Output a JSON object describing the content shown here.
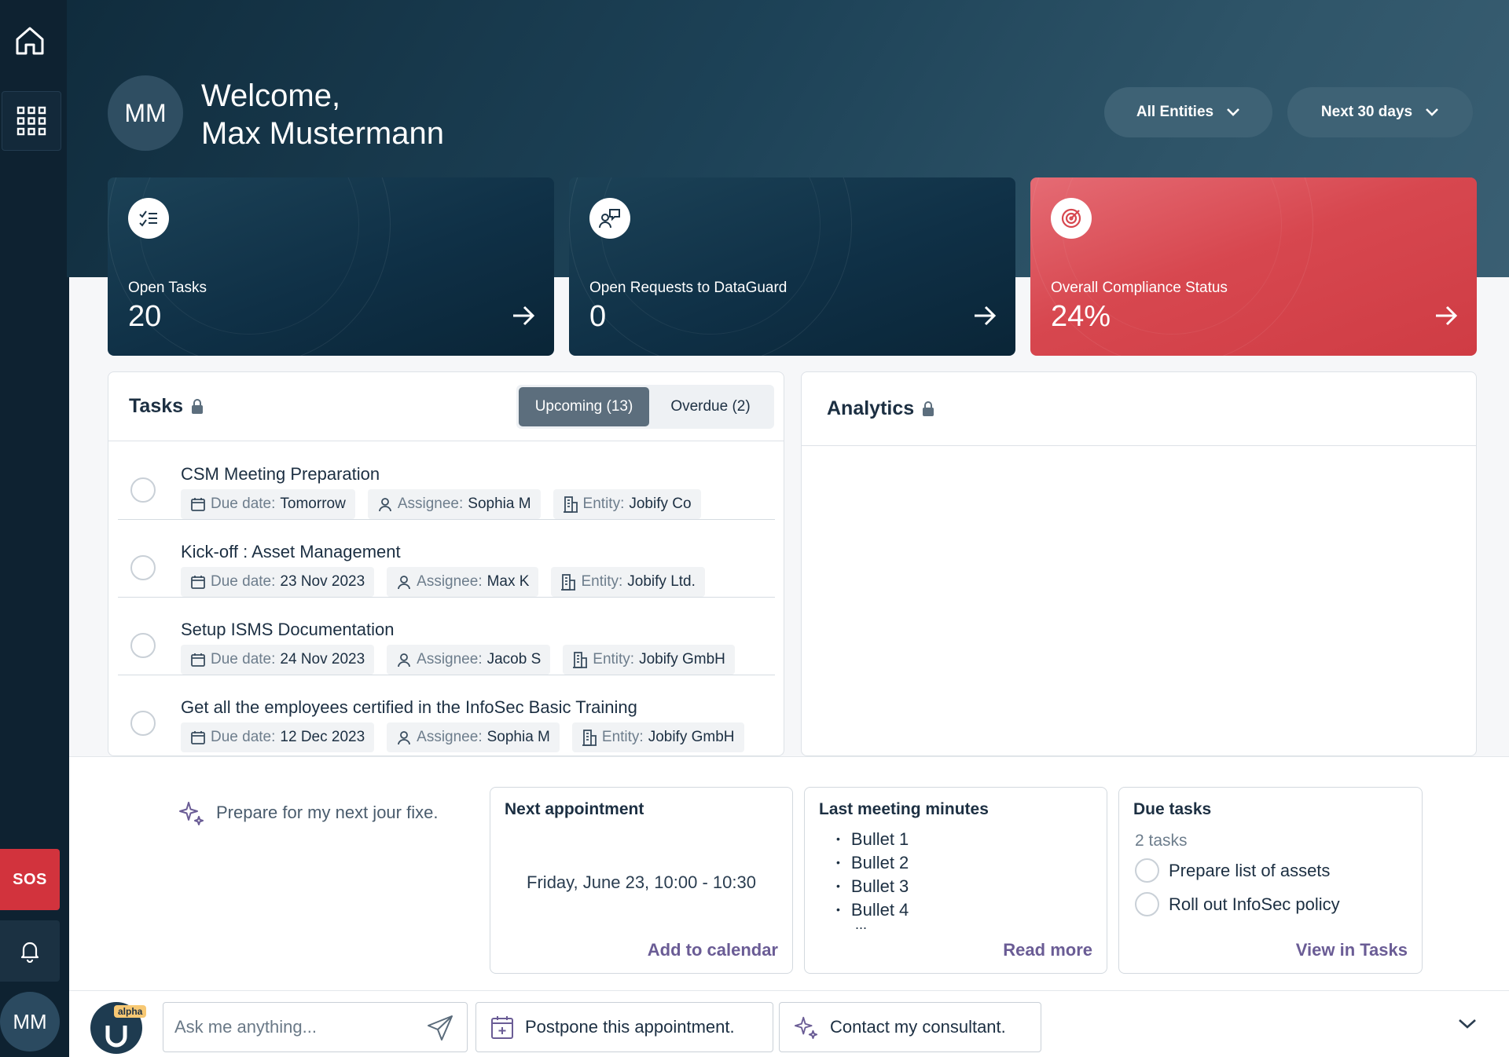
{
  "sidebar": {
    "sos_label": "SOS",
    "avatar_initials": "MM"
  },
  "header": {
    "avatar_initials": "MM",
    "welcome_line1": "Welcome,",
    "welcome_line2": "Max Mustermann",
    "filter_entities": "All Entities",
    "filter_period": "Next 30 days"
  },
  "kpis": [
    {
      "label": "Open Tasks",
      "value": "20"
    },
    {
      "label": "Open Requests to DataGuard",
      "value": "0"
    },
    {
      "label": "Overall Compliance Status",
      "value": "24%"
    }
  ],
  "tasks": {
    "title": "Tasks",
    "tab_upcoming": "Upcoming (13)",
    "tab_overdue": "Overdue (2)",
    "due_key": "Due date:",
    "assignee_key": "Assignee:",
    "entity_key": "Entity:",
    "items": [
      {
        "title": "CSM Meeting Preparation",
        "due": "Tomorrow",
        "assignee": "Sophia M",
        "entity": "Jobify Co"
      },
      {
        "title": "Kick-off : Asset Management",
        "due": "23 Nov 2023",
        "assignee": "Max K",
        "entity": "Jobify Ltd."
      },
      {
        "title": "Setup ISMS Documentation",
        "due": "24 Nov 2023",
        "assignee": "Jacob S",
        "entity": "Jobify GmbH"
      },
      {
        "title": "Get all the employees certified in the InfoSec Basic Training",
        "due": "12 Dec 2023",
        "assignee": "Sophia M",
        "entity": "Jobify GmbH"
      }
    ]
  },
  "analytics": {
    "title": "Analytics"
  },
  "assistant": {
    "prompt": "Prepare for my next jour fixe.",
    "next_appointment": {
      "title": "Next appointment",
      "time": "Friday, June 23, 10:00 - 10:30",
      "link": "Add to calendar"
    },
    "last_minutes": {
      "title": "Last meeting minutes",
      "bullets": [
        "Bullet 1",
        "Bullet 2",
        "Bullet 3",
        "Bullet 4"
      ],
      "ellipsis": "...",
      "link": "Read more"
    },
    "due_tasks": {
      "title": "Due tasks",
      "count": "2 tasks",
      "items": [
        "Prepare list of assets",
        "Roll out InfoSec policy"
      ],
      "link": "View in Tasks"
    },
    "badge": "alpha",
    "input_placeholder": "Ask me anything...",
    "quick_postpone": "Postpone this appointment.",
    "quick_contact": "Contact my consultant."
  },
  "colors": {
    "accent_red": "#d7474f",
    "dark_navy": "#0e2231",
    "link_purple": "#6a5c95"
  }
}
